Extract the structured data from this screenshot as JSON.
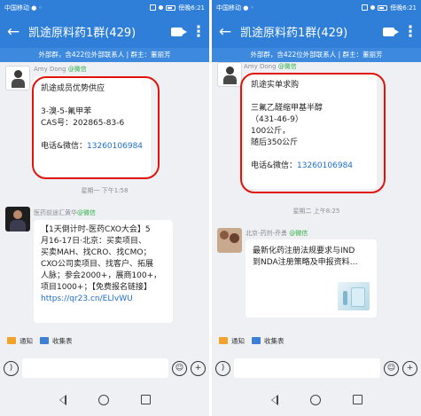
{
  "status_bar": {
    "carrier": "中国移动 ● ◦",
    "time": "傍晚6:21"
  },
  "header": {
    "title": "凯途原料药1群(429)",
    "subtitle": "外部群，含422位外部联系人 | 群主：董丽芳"
  },
  "left_chat": {
    "msg1": {
      "sender": "Amy Dong",
      "sender_tag": "@微信",
      "lines": [
        "凯途成员优势供应",
        "",
        "3-溴-5-氟甲苯",
        "CAS号：202865-83-6",
        "",
        "电话&微信："
      ],
      "phone": "13260106984"
    },
    "time_separator": "星期一 下午1:58",
    "msg2": {
      "sender": "医药前途汇黄华",
      "sender_tag": "@微信",
      "lines": [
        "【1天倒计时-医药CXO大会】5",
        "月16-17日·北京：买卖项目、",
        "买卖MAH、找CRO、找CMO；",
        "CXO公司卖项目、找客户、拓展",
        "人脉；参会2000+，展商100+，",
        "项目1000+；【免费报名链接】"
      ],
      "link": "https://qr23.cn/ELlvWU"
    }
  },
  "right_chat": {
    "msg1": {
      "sender": "Amy Dong",
      "sender_tag": "@微信",
      "lines": [
        "凯途实单求购",
        "",
        "三氟乙醛缩甲基半醇",
        "（431-46-9）",
        "100公斤，",
        "随后350公斤",
        "",
        "电话&微信："
      ],
      "phone": "13260106984"
    },
    "time_separator": "星期二 上午8:25",
    "msg2": {
      "sender": "北京-药剂-乔勇",
      "sender_tag": "@微信",
      "card_lines": [
        "最新化药注册法规要求与IND",
        "到NDA注册策略及申报资料…"
      ]
    }
  },
  "quick_actions": {
    "notice": "通知",
    "collect": "收集表"
  },
  "colors": {
    "header_blue": "#2f7fd8",
    "highlight_red": "#e3120b",
    "link_blue": "#1d6fc9",
    "wechat_green": "#2fae47"
  }
}
